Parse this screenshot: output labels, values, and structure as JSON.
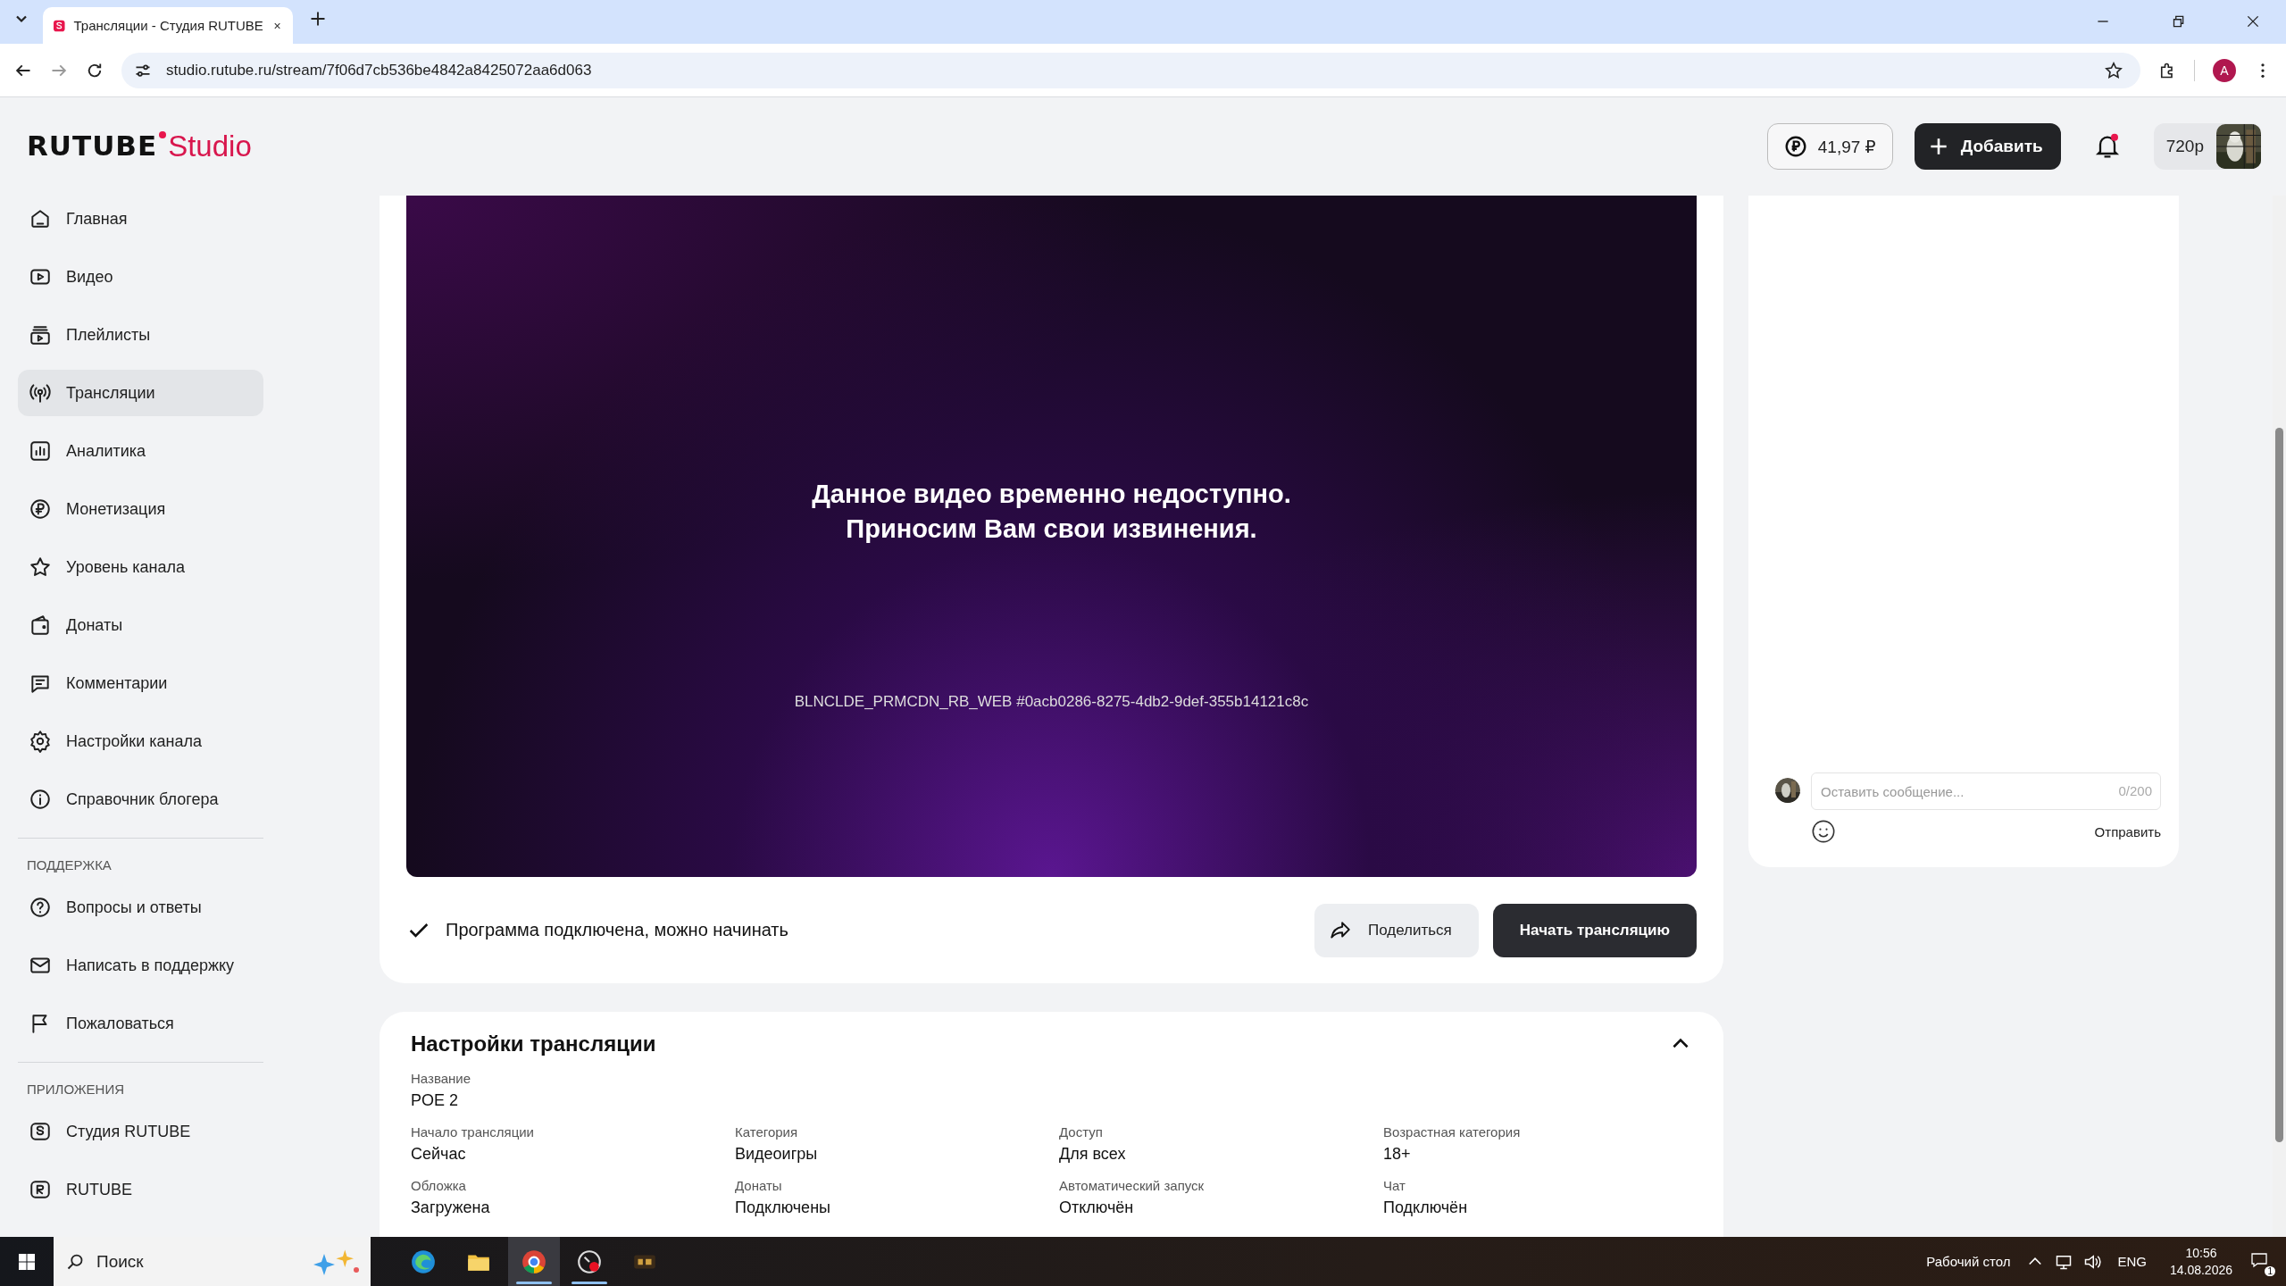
{
  "browser": {
    "tabs": [
      {
        "title": "Трансляции - Студия RUTUBE",
        "selected": true
      }
    ],
    "url": "studio.rutube.ru/stream/7f06d7cb536be4842a8425072aa6d063",
    "profile_letter": "A"
  },
  "header": {
    "logo_main": "RUTUBE",
    "logo_sub": "Studio",
    "balance": "41,97 ₽",
    "add_button": "Добавить",
    "has_notifications": true,
    "quality": "720p"
  },
  "sidebar": {
    "sections": [
      {
        "items": [
          {
            "label": "Главная",
            "kind": "home",
            "selected": false
          },
          {
            "label": "Видео",
            "kind": "video",
            "selected": false
          },
          {
            "label": "Плейлисты",
            "kind": "playlist",
            "selected": false
          },
          {
            "label": "Трансляции",
            "kind": "broadcast",
            "selected": true
          },
          {
            "label": "Аналитика",
            "kind": "chart",
            "selected": false
          },
          {
            "label": "Монетизация",
            "kind": "ruble",
            "selected": false
          },
          {
            "label": "Уровень канала",
            "kind": "star",
            "selected": false
          },
          {
            "label": "Донаты",
            "kind": "wallet",
            "selected": false
          },
          {
            "label": "Комментарии",
            "kind": "comment",
            "selected": false
          },
          {
            "label": "Настройки канала",
            "kind": "gear",
            "selected": false
          },
          {
            "label": "Справочник блогера",
            "kind": "info",
            "selected": false
          }
        ]
      },
      {
        "heading": "ПОДДЕРЖКА",
        "items": [
          {
            "label": "Вопросы и ответы",
            "kind": "question",
            "selected": false
          },
          {
            "label": "Написать в поддержку",
            "kind": "mail",
            "selected": false
          },
          {
            "label": "Пожаловаться",
            "kind": "flag",
            "selected": false
          }
        ]
      },
      {
        "heading": "ПРИЛОЖЕНИЯ",
        "items": [
          {
            "label": "Студия RUTUBE",
            "kind": "app-s",
            "selected": false
          },
          {
            "label": "RUTUBE",
            "kind": "app-r",
            "selected": false
          }
        ]
      }
    ]
  },
  "player": {
    "message": [
      "Данное видео временно недоступно.",
      "Приносим Вам свои извинения."
    ],
    "error_code": "BLNCLDE_PRMCDN_RB_WEB #0acb0286-8275-4db2-9def-355b14121c8c"
  },
  "status": {
    "text": "Программа подключена, можно начинать",
    "share_button": "Поделиться",
    "start_button": "Начать трансляцию"
  },
  "settings": {
    "title": "Настройки трансляции",
    "expanded": true,
    "name": {
      "label": "Название",
      "value": "POE 2"
    },
    "fields": [
      {
        "label": "Начало трансляции",
        "value": "Сейчас"
      },
      {
        "label": "Категория",
        "value": "Видеоигры"
      },
      {
        "label": "Доступ",
        "value": "Для всех"
      },
      {
        "label": "Возрастная категория",
        "value": "18+"
      },
      {
        "label": "Обложка",
        "value": "Загружена"
      },
      {
        "label": "Донаты",
        "value": "Подключены"
      },
      {
        "label": "Автоматический запуск",
        "value": "Отключён"
      },
      {
        "label": "Чат",
        "value": "Подключён"
      }
    ]
  },
  "chat": {
    "placeholder": "Оставить сообщение...",
    "counter": "0/200",
    "send_button": "Отправить"
  },
  "taskbar": {
    "search_placeholder": "Поиск",
    "apps": [
      {
        "kind": "edge",
        "active": false,
        "running": false
      },
      {
        "kind": "folder",
        "active": false,
        "running": false
      },
      {
        "kind": "chrome",
        "active": true,
        "running": true
      },
      {
        "kind": "recorder",
        "active": false,
        "running": true
      },
      {
        "kind": "game",
        "active": false,
        "running": false
      }
    ],
    "desktop_label": "Рабочий стол",
    "language": "ENG",
    "time": "10:56",
    "date": "14.08.2026",
    "notification_count": "1"
  }
}
